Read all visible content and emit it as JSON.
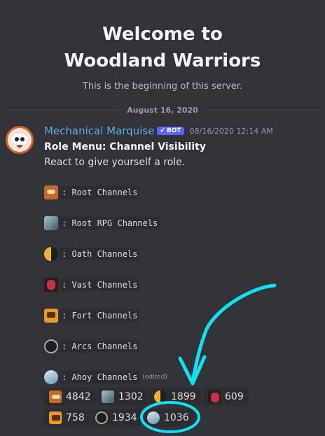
{
  "welcome": {
    "title_line1": "Welcome to",
    "title_line2": "Woodland Warriors",
    "subtitle": "This is the beginning of this server."
  },
  "date_divider": "August 16, 2020",
  "message": {
    "username": "Mechanical Marquise",
    "bot_tag": "BOT",
    "timestamp": "08/16/2020 12:14 AM",
    "title": "Role Menu: Channel Visibility",
    "body": "React to give yourself a role.",
    "edited_label": "(edited)",
    "roles": [
      {
        "emoji": "root-emoji",
        "label": ": Root Channels"
      },
      {
        "emoji": "root-rpg-emoji",
        "label": ": Root RPG Channels"
      },
      {
        "emoji": "oath-emoji",
        "label": ": Oath Channels"
      },
      {
        "emoji": "vast-emoji",
        "label": ": Vast Channels"
      },
      {
        "emoji": "fort-emoji",
        "label": ": Fort Channels"
      },
      {
        "emoji": "arcs-emoji",
        "label": ": Arcs Channels"
      },
      {
        "emoji": "ahoy-emoji",
        "label": ": Ahoy Channels"
      }
    ],
    "reactions": [
      {
        "emoji": "root-emoji",
        "count": "4842"
      },
      {
        "emoji": "root-rpg-emoji",
        "count": "1302"
      },
      {
        "emoji": "oath-emoji",
        "count": "1899"
      },
      {
        "emoji": "vast-emoji",
        "count": "609"
      },
      {
        "emoji": "fort-emoji",
        "count": "758"
      },
      {
        "emoji": "arcs-emoji",
        "count": "1934"
      },
      {
        "emoji": "ahoy-emoji",
        "count": "1036"
      }
    ]
  },
  "colors": {
    "background": "#313338",
    "username": "#5ab0e8",
    "bot_tag": "#5865f2",
    "annotation": "#12e0f0"
  }
}
